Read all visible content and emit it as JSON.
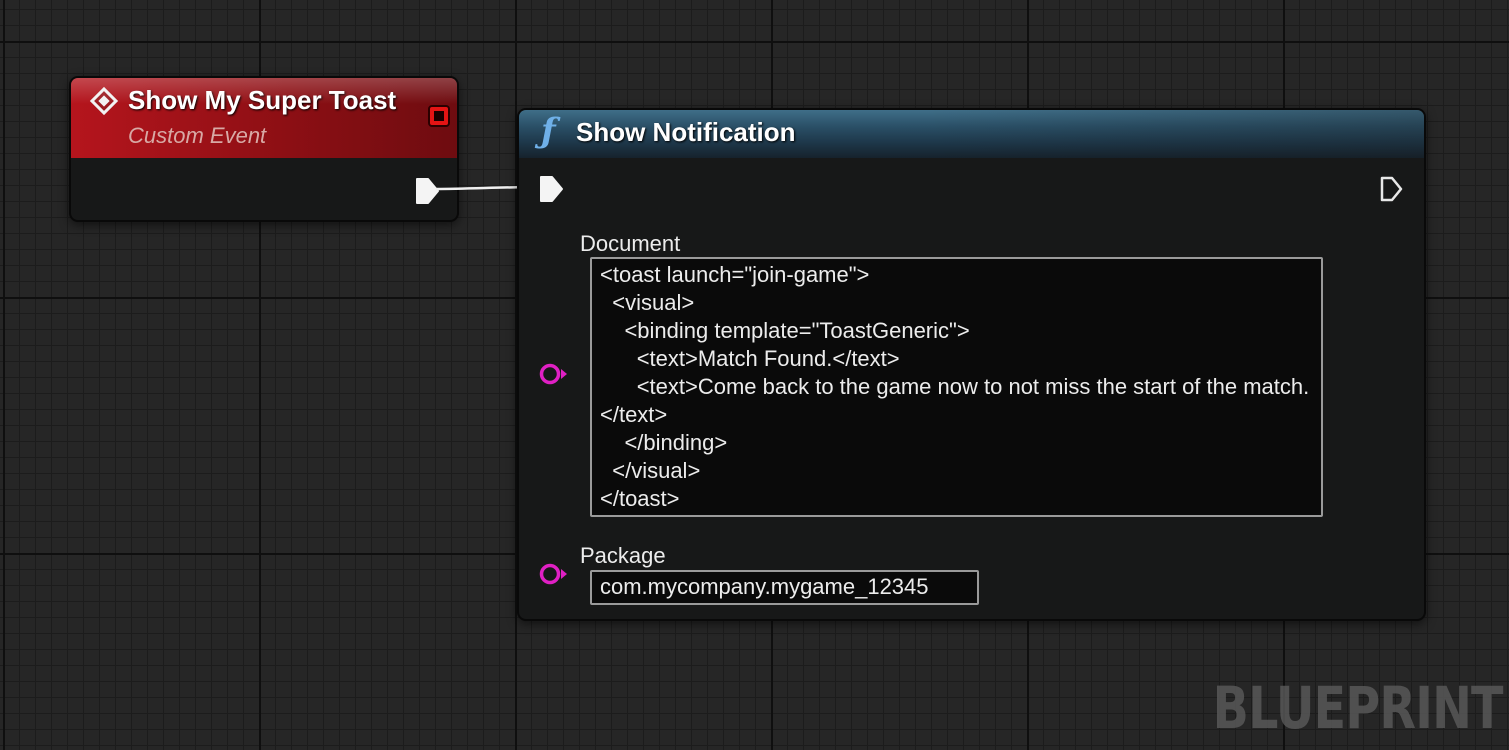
{
  "event_node": {
    "icon": "custom-event-diamond-icon",
    "title": "Show My Super Toast",
    "subtitle": "Custom Event",
    "header_color": "#a01319"
  },
  "function_node": {
    "icon": "function-icon",
    "title": "Show Notification",
    "header_color": "#2a4f66",
    "pins": {
      "document": {
        "label": "Document",
        "value": "<toast launch=\"join-game\">\n  <visual>\n    <binding template=\"ToastGeneric\">\n      <text>Match Found.</text>\n      <text>Come back to the game now to not miss the start of the match.</text>\n    </binding>\n  </visual>\n</toast>",
        "pin_color": "#e020c4"
      },
      "package": {
        "label": "Package",
        "value": "com.mycompany.mygame_12345",
        "pin_color": "#e020c4"
      }
    }
  },
  "watermark": "BLUEPRINT"
}
